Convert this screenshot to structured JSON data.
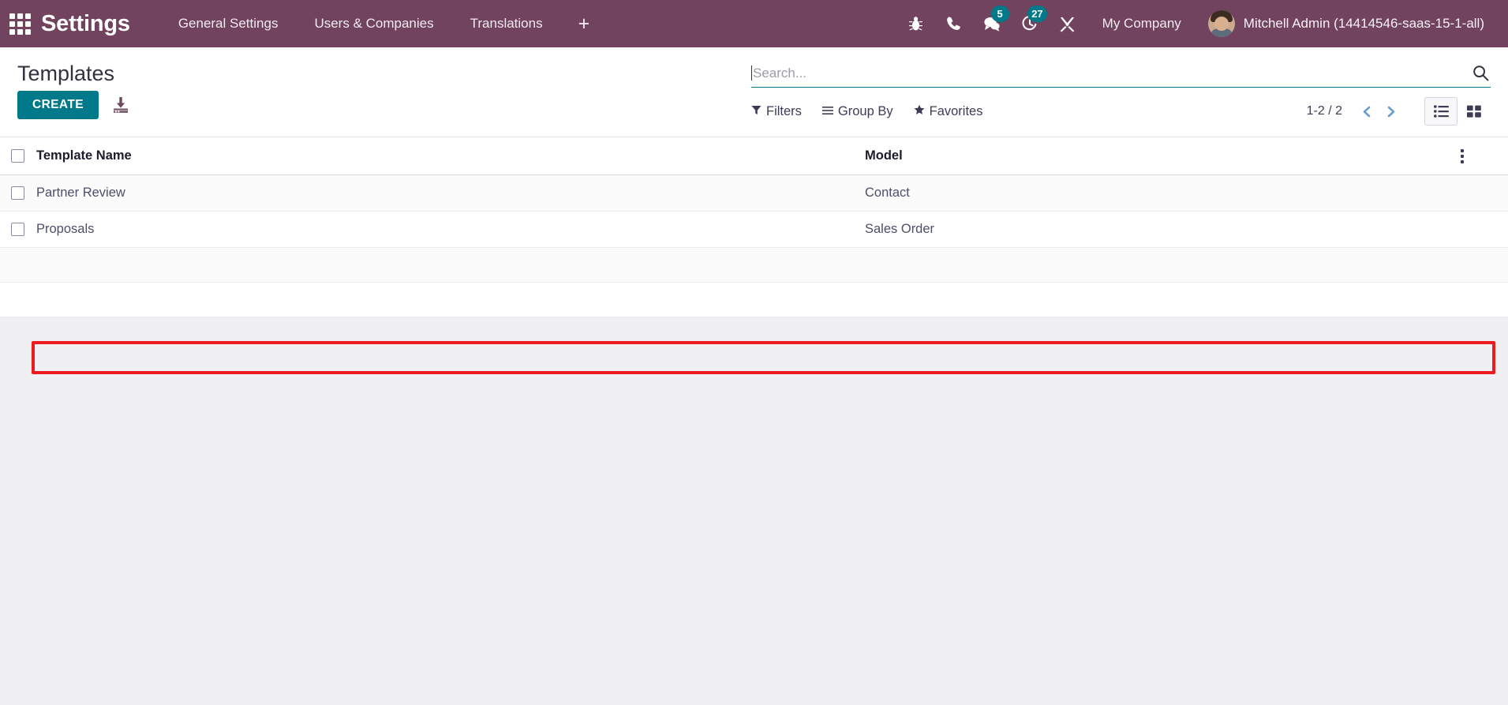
{
  "navbar": {
    "apps_icon": "apps-grid-icon",
    "brand": "Settings",
    "menu_items": [
      {
        "label": "General Settings"
      },
      {
        "label": "Users & Companies"
      },
      {
        "label": "Translations"
      }
    ],
    "add_menu_label": "+",
    "icons": [
      {
        "name": "bug-icon",
        "badge": null
      },
      {
        "name": "phone-icon",
        "badge": null
      },
      {
        "name": "messages-icon",
        "badge": "5"
      },
      {
        "name": "activities-clock-icon",
        "badge": "27"
      },
      {
        "name": "developer-tools-icon",
        "badge": null
      }
    ],
    "company": "My Company",
    "user": "Mitchell Admin (14414546-saas-15-1-all)",
    "bg_color": "#71435f",
    "badge_color": "#00798a"
  },
  "control_panel": {
    "breadcrumb": "Templates",
    "create_label": "CREATE",
    "import_icon": "import-records-icon",
    "create_color": "#00798a"
  },
  "search": {
    "placeholder": "Search...",
    "value": "",
    "search_icon": "search-icon",
    "underline_color": "#00798a"
  },
  "filters": [
    {
      "label": "Filters",
      "icon": "funnel-icon"
    },
    {
      "label": "Group By",
      "icon": "hamburger-icon"
    },
    {
      "label": "Favorites",
      "icon": "star-icon"
    }
  ],
  "pager": {
    "count": "1-2 / 2",
    "prev_icon": "chevron-left-icon",
    "next_icon": "chevron-right-icon"
  },
  "views": [
    {
      "name": "list-view",
      "icon": "list-icon",
      "active": true
    },
    {
      "name": "kanban-view",
      "icon": "kanban-icon",
      "active": false
    }
  ],
  "list": {
    "columns": [
      "Template Name",
      "Model"
    ],
    "optional_columns_icon": "vertical-dots-icon",
    "rows": [
      {
        "name": "Partner Review",
        "model": "Contact",
        "selected": false,
        "highlighted": false
      },
      {
        "name": "Proposals",
        "model": "Sales Order",
        "selected": false,
        "highlighted": true
      }
    ]
  },
  "annotation": {
    "color": "#ee1b20",
    "target": "Proposals"
  }
}
